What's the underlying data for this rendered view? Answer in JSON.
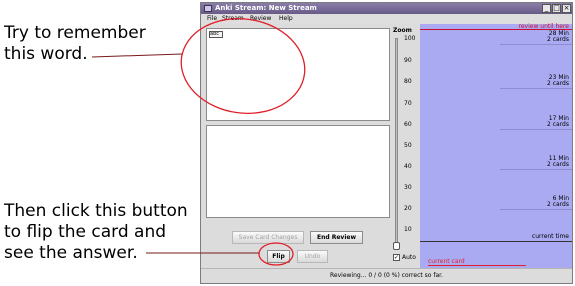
{
  "annotations": {
    "top_line1": "Try to remember",
    "top_line2": "this word.",
    "bottom_line1": "Then click this button",
    "bottom_line2": "to flip the card and",
    "bottom_line3": "see the answer."
  },
  "window": {
    "title": "Anki Stream: New Stream",
    "controls": {
      "minimize": "_",
      "maximize": "□",
      "close": "×"
    }
  },
  "menu": [
    "File",
    "Stream",
    "Review",
    "Help"
  ],
  "question_panel": {
    "icon": "card-thumbnail-icon",
    "icon_text": "abc"
  },
  "buttons": {
    "save_changes": "Save Card Changes",
    "end_review": "End Review",
    "flip": "Flip",
    "undo": "Undo"
  },
  "zoom": {
    "label": "Zoom",
    "ticks": [
      "100",
      "90",
      "80",
      "70",
      "60",
      "50",
      "40",
      "30",
      "20",
      "10"
    ],
    "auto_label": "Auto",
    "auto_checked": true
  },
  "timeline": {
    "review_until_label": "review until here",
    "current_time_label": "current time",
    "current_card_label": "current card",
    "groups": [
      {
        "time": "28 Min",
        "cards": "2 cards"
      },
      {
        "time": "23 Min",
        "cards": "2 cards"
      },
      {
        "time": "17 Min",
        "cards": "2 cards"
      },
      {
        "time": "11 Min",
        "cards": "2 cards"
      },
      {
        "time": "6 Min",
        "cards": "2 cards"
      }
    ]
  },
  "status": {
    "text": "Reviewing... 0 / 0 (0 %) correct so far."
  },
  "colors": {
    "timeline_bg": "#aaaaf2",
    "annotation_red": "#e0202a",
    "review_until_red": "#c8102e",
    "current_card_red": "#e0202a",
    "titlebar": "#675a87"
  }
}
